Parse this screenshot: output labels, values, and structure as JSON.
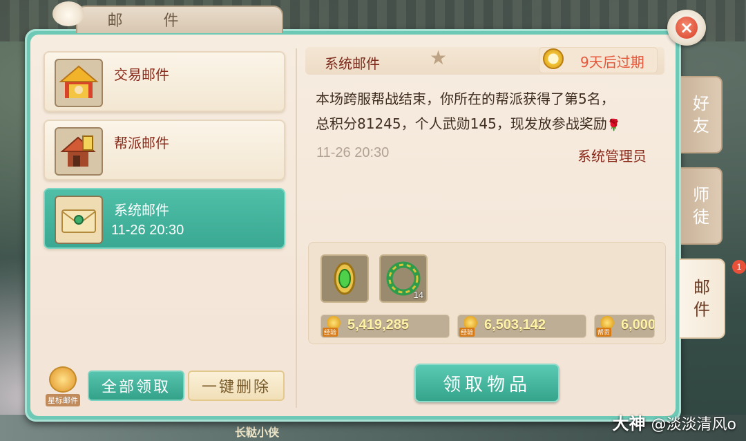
{
  "window": {
    "title": "邮  件",
    "close_label": "×"
  },
  "mail_list": [
    {
      "label": "交易邮件",
      "icon": "trade-shop-icon"
    },
    {
      "label": "帮派邮件",
      "icon": "guild-building-icon"
    },
    {
      "label": "系统邮件",
      "time": "11-26 20:30",
      "icon": "envelope-icon",
      "selected": true
    }
  ],
  "bottom_buttons": {
    "star_mail": "星标邮件",
    "collect_all": "全部领取",
    "delete_all": "一键删除"
  },
  "detail": {
    "title": "系统邮件",
    "expire": "9天后过期",
    "body_line1": "本场跨服帮战结束，你所在的帮派获得了第5名，",
    "body_line2": "总积分81245，个人武勋145，现发放参战奖励",
    "date": "11-26 20:30",
    "sender": "系统管理员",
    "rewards": [
      {
        "icon": "green-gem-icon",
        "qty": ""
      },
      {
        "icon": "jade-ring-icon",
        "qty": "14"
      }
    ],
    "resources": [
      {
        "tag": "经验",
        "value": "5,419,285"
      },
      {
        "tag": "经验",
        "value": "6,503,142"
      },
      {
        "tag": "帮贡",
        "value": "6,000"
      }
    ],
    "claim_button": "领取物品"
  },
  "side_tabs": [
    {
      "label_top": "好",
      "label_bottom": "友"
    },
    {
      "label_top": "师",
      "label_bottom": "徒"
    },
    {
      "label_top": "邮",
      "label_bottom": "件",
      "active": true,
      "badge": "1"
    }
  ],
  "scene": {
    "npc_name": "长鞑小侠",
    "watermark_main": "大神",
    "watermark_sub": "@淡淡清风o"
  },
  "colors": {
    "accent": "#3aa892",
    "expire_red": "#e4573b",
    "title_red": "#8a2a1a"
  }
}
